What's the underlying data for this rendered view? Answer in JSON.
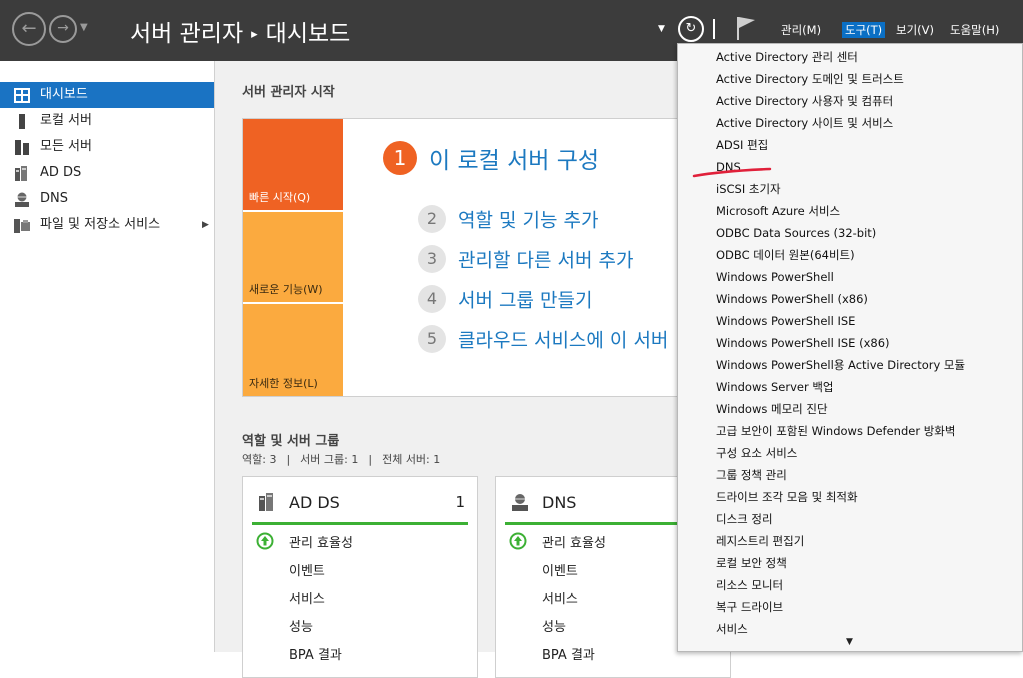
{
  "titlebar": {
    "breadcrumb_app": "서버 관리자",
    "breadcrumb_separator": "▸",
    "breadcrumb_page": "대시보드",
    "menus": {
      "manage": "관리(M)",
      "tools": "도구(T)",
      "view": "보기(V)",
      "help": "도움말(H)"
    },
    "icons": [
      "back-icon",
      "forward-icon",
      "refresh-icon",
      "flag-icon"
    ]
  },
  "sidebar": {
    "items": [
      {
        "label": "대시보드",
        "icon": "dashboard-icon",
        "selected": true
      },
      {
        "label": "로컬 서버",
        "icon": "local-server-icon"
      },
      {
        "label": "모든 서버",
        "icon": "all-servers-icon"
      },
      {
        "label": "AD DS",
        "icon": "ad-ds-icon"
      },
      {
        "label": "DNS",
        "icon": "dns-icon"
      },
      {
        "label": "파일 및 저장소 서비스",
        "icon": "file-storage-icon",
        "has_submenu": true
      }
    ]
  },
  "quickstart": {
    "section_title": "서버 관리자 시작",
    "tiles": [
      "빠른 시작(Q)",
      "새로운 기능(W)",
      "자세한 정보(L)"
    ],
    "steps": [
      {
        "num": "1",
        "text": "이 로컬 서버 구성"
      },
      {
        "num": "2",
        "text": "역할 및 기능 추가"
      },
      {
        "num": "3",
        "text": "관리할 다른 서버 추가"
      },
      {
        "num": "4",
        "text": "서버 그룹 만들기"
      },
      {
        "num": "5",
        "text": "클라우드 서비스에 이 서버"
      }
    ]
  },
  "roles": {
    "section_title": "역할 및 서버 그룹",
    "stat_roles": "역할: 3",
    "stat_groups": "서버 그룹: 1",
    "stat_total": "전체 서버: 1",
    "stat_sep": "|",
    "cards": [
      {
        "title": "AD DS",
        "count": "1",
        "rows": [
          "관리 효율성",
          "이벤트",
          "서비스",
          "성능",
          "BPA 결과"
        ]
      },
      {
        "title": "DNS",
        "count": "",
        "rows": [
          "관리 효율성",
          "이벤트",
          "서비스",
          "성능",
          "BPA 결과"
        ]
      }
    ]
  },
  "tools_menu": {
    "items": [
      "Active Directory 관리 센터",
      "Active Directory 도메인 및 트러스트",
      "Active Directory 사용자 및 컴퓨터",
      "Active Directory 사이트 및 서비스",
      "ADSI 편집",
      "DNS",
      "iSCSI 초기자",
      "Microsoft Azure 서비스",
      "ODBC Data Sources (32-bit)",
      "ODBC 데이터 원본(64비트)",
      "Windows PowerShell",
      "Windows PowerShell (x86)",
      "Windows PowerShell ISE",
      "Windows PowerShell ISE (x86)",
      "Windows PowerShell용 Active Directory 모듈",
      "Windows Server 백업",
      "Windows 메모리 진단",
      "고급 보안이 포함된 Windows Defender 방화벽",
      "구성 요소 서비스",
      "그룹 정책 관리",
      "드라이브 조각 모음 및 최적화",
      "디스크 정리",
      "레지스트리 편집기",
      "로컬 보안 정책",
      "리소스 모니터",
      "복구 드라이브",
      "서비스"
    ],
    "highlighted_item": "DNS",
    "annotation_color": "#e0203a"
  },
  "colors": {
    "titlebar_bg": "#3c3c3c",
    "selection_blue": "#1a73c3",
    "quickstart_orange": "#ef6223",
    "tile_yellow": "#fbaa3f",
    "status_green": "#3cb034",
    "link_blue": "#1c79c0"
  }
}
